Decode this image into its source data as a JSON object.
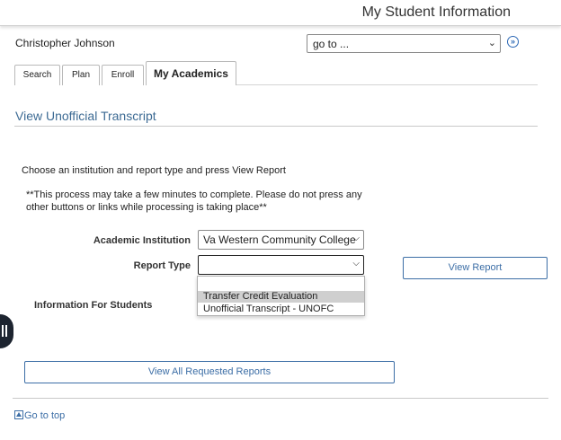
{
  "header": {
    "title": "My Student Information"
  },
  "student": {
    "name": "Christopher Johnson"
  },
  "nav": {
    "goto_value": "go to ...",
    "goto_button": "»"
  },
  "tabs": [
    {
      "label": "Search"
    },
    {
      "label": "Plan"
    },
    {
      "label": "Enroll"
    },
    {
      "label": "My Academics",
      "active": true
    }
  ],
  "page": {
    "title": "View Unofficial Transcript",
    "instructions": "Choose an institution and report type and press View Report",
    "warning": "**This process may take a few minutes to complete. Please do not press any other buttons or links while processing is taking place**"
  },
  "form": {
    "institution_label": "Academic Institution",
    "institution_value": "Va Western Community College",
    "report_type_label": "Report Type",
    "report_type_value": "",
    "report_type_options": [
      "",
      "Transfer Credit Evaluation",
      "Unofficial Transcript - UNOFC"
    ],
    "view_report_button": "View Report"
  },
  "info": {
    "label": "Information For Students"
  },
  "actions": {
    "view_all_button": "View All Requested Reports"
  },
  "footer": {
    "go_to_top": "Go to top"
  },
  "colors": {
    "link_blue": "#3c6ea6",
    "title_blue": "#3d6b94",
    "highlight": "#cfcfcf"
  }
}
